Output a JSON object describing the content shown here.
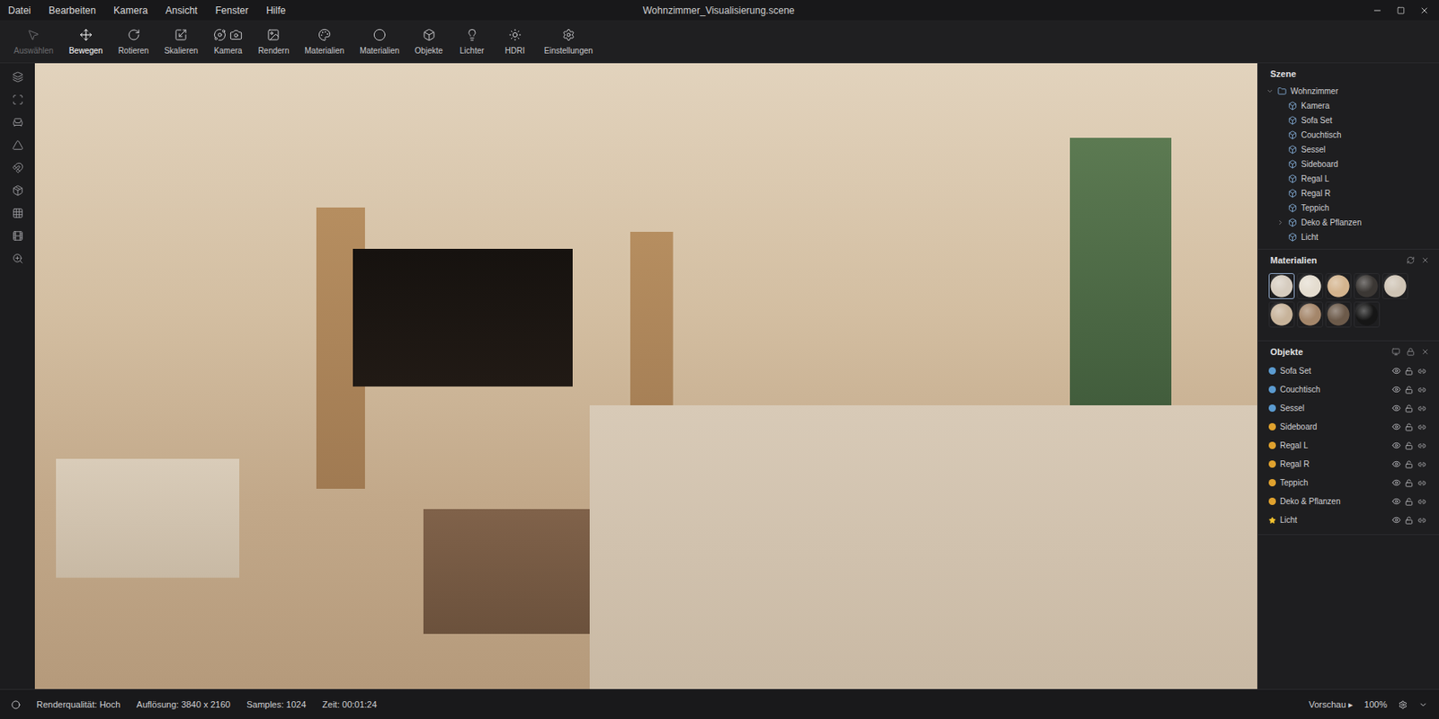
{
  "window": {
    "title": "Wohnzimmer_Visualisierung.scene"
  },
  "menu": [
    "Datei",
    "Bearbeiten",
    "Kamera",
    "Ansicht",
    "Fenster",
    "Hilfe"
  ],
  "toolbar": [
    {
      "label": "Auswählen",
      "selected": false,
      "disabled": true
    },
    {
      "label": "Bewegen",
      "selected": true,
      "disabled": false
    },
    {
      "label": "Rotieren",
      "selected": false,
      "disabled": false
    },
    {
      "label": "Skalieren",
      "selected": false,
      "disabled": false
    },
    {
      "label": "Kamera",
      "selected": false,
      "disabled": false
    },
    {
      "label": "Rendern",
      "selected": false,
      "disabled": false
    },
    {
      "label": "Materialien",
      "selected": false,
      "disabled": false
    },
    {
      "label": "Materialien",
      "selected": false,
      "disabled": false
    },
    {
      "label": "Objekte",
      "selected": false,
      "disabled": false
    },
    {
      "label": "Lichter",
      "selected": false,
      "disabled": false
    },
    {
      "label": "HDRI",
      "selected": false,
      "disabled": false
    },
    {
      "label": "Einstellungen",
      "selected": false,
      "disabled": false
    }
  ],
  "scene": {
    "title": "Szene",
    "root": {
      "label": "Wohnzimmer",
      "expanded": true,
      "children": [
        {
          "label": "Kamera",
          "expandable": false,
          "expanded": false
        },
        {
          "label": "Sofa Set",
          "expandable": false,
          "expanded": false
        },
        {
          "label": "Couchtisch",
          "expandable": false,
          "expanded": false
        },
        {
          "label": "Sessel",
          "expandable": false,
          "expanded": false
        },
        {
          "label": "Sideboard",
          "expandable": false,
          "expanded": false
        },
        {
          "label": "Regal L",
          "expandable": false,
          "expanded": false
        },
        {
          "label": "Regal R",
          "expandable": false,
          "expanded": false
        },
        {
          "label": "Teppich",
          "expandable": false,
          "expanded": false
        },
        {
          "label": "Deko & Pflanzen",
          "expandable": true,
          "expanded": false
        },
        {
          "label": "Licht",
          "expandable": false,
          "expanded": false
        }
      ]
    }
  },
  "materials": {
    "title": "Materialien",
    "swatches": [
      {
        "color": "#d6ccbf",
        "selected": true
      },
      {
        "color": "#e4dccf",
        "selected": false
      },
      {
        "color": "#d4b48e",
        "selected": false
      },
      {
        "color": "#3b3734",
        "selected": false
      },
      {
        "color": "#cfc4b5",
        "selected": false
      },
      {
        "color": "#c7b39a",
        "selected": false
      },
      {
        "color": "#a4866a",
        "selected": false
      },
      {
        "color": "#6c5a4a",
        "selected": false
      },
      {
        "color": "#161616",
        "selected": false
      }
    ]
  },
  "objects": {
    "title": "Objekte",
    "items": [
      {
        "label": "Sofa Set",
        "kind": "mesh",
        "color": "#5b9bd0",
        "visible": true,
        "locked": false
      },
      {
        "label": "Couchtisch",
        "kind": "mesh",
        "color": "#5b9bd0",
        "visible": true,
        "locked": false
      },
      {
        "label": "Sessel",
        "kind": "mesh",
        "color": "#5b9bd0",
        "visible": true,
        "locked": false
      },
      {
        "label": "Sideboard",
        "kind": "mesh",
        "color": "#e0a22e",
        "visible": true,
        "locked": false
      },
      {
        "label": "Regal L",
        "kind": "mesh",
        "color": "#e0a22e",
        "visible": true,
        "locked": false
      },
      {
        "label": "Regal R",
        "kind": "mesh",
        "color": "#e0a22e",
        "visible": true,
        "locked": false
      },
      {
        "label": "Teppich",
        "kind": "mesh",
        "color": "#e0a22e",
        "visible": true,
        "locked": false
      },
      {
        "label": "Deko & Pflanzen",
        "kind": "mesh",
        "color": "#e0a22e",
        "visible": true,
        "locked": false
      },
      {
        "label": "Licht",
        "kind": "light",
        "color": "#f2c230",
        "visible": true,
        "locked": false
      }
    ]
  },
  "status_bar": {
    "items": [
      "Renderqualität: Hoch",
      "Auflösung: 3840 x 2160",
      "Samples: 1024",
      "Zeit: 00:01:24"
    ],
    "preview": "Vorschau ▸",
    "zoom": "100%"
  }
}
